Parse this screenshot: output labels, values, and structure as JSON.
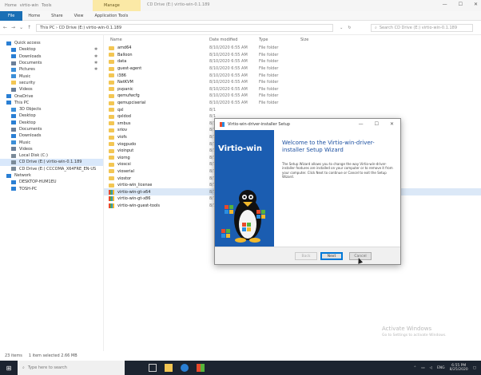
{
  "titlebar": {
    "qat_labels": [
      "Home",
      "virtio-win",
      "Tools"
    ],
    "ribbon_context": "Manage",
    "title": "CD Drive (E:) virtio-win-0.1.189",
    "controls": [
      "—",
      "☐",
      "✕"
    ]
  },
  "ribbon": {
    "file": "File",
    "tabs": [
      "Home",
      "Share",
      "View",
      "Application Tools"
    ]
  },
  "address": {
    "path": "This PC  ›  CD Drive (E:) virtio-win-0.1.189",
    "search_placeholder": "Search CD Drive (E:) virtio-win-0.1.189"
  },
  "nav": {
    "items": [
      {
        "label": "Quick access",
        "icon": "star-icon",
        "color": "#2a7fd4",
        "indent": false,
        "pinned": false
      },
      {
        "label": "Desktop",
        "icon": "desktop-icon",
        "color": "#2a7fd4",
        "indent": true,
        "pinned": true
      },
      {
        "label": "Downloads",
        "icon": "download-icon",
        "color": "#2a7fd4",
        "indent": true,
        "pinned": true
      },
      {
        "label": "Documents",
        "icon": "document-icon",
        "color": "#6b7f99",
        "indent": true,
        "pinned": true
      },
      {
        "label": "Pictures",
        "icon": "picture-icon",
        "color": "#3c8fd8",
        "indent": true,
        "pinned": true
      },
      {
        "label": "Music",
        "icon": "music-icon",
        "color": "#3c8fd8",
        "indent": true,
        "pinned": false
      },
      {
        "label": "security",
        "icon": "folder-icon",
        "color": "#f3c653",
        "indent": true,
        "pinned": false
      },
      {
        "label": "Videos",
        "icon": "video-icon",
        "color": "#6b7f99",
        "indent": true,
        "pinned": false
      },
      {
        "label": "OneDrive",
        "icon": "cloud-icon",
        "color": "#2a7fd4",
        "indent": false,
        "pinned": false
      },
      {
        "label": "This PC",
        "icon": "pc-icon",
        "color": "#2a7fd4",
        "indent": false,
        "pinned": false
      },
      {
        "label": "3D Objects",
        "icon": "cube-icon",
        "color": "#3c8fd8",
        "indent": true,
        "pinned": false
      },
      {
        "label": "Desktop",
        "icon": "desktop-icon",
        "color": "#2a7fd4",
        "indent": true,
        "pinned": false
      },
      {
        "label": "Desktop",
        "icon": "desktop-icon",
        "color": "#2a7fd4",
        "indent": true,
        "pinned": false
      },
      {
        "label": "Documents",
        "icon": "document-icon",
        "color": "#6b7f99",
        "indent": true,
        "pinned": false
      },
      {
        "label": "Downloads",
        "icon": "download-icon",
        "color": "#2a7fd4",
        "indent": true,
        "pinned": false
      },
      {
        "label": "Music",
        "icon": "music-icon",
        "color": "#3c8fd8",
        "indent": true,
        "pinned": false
      },
      {
        "label": "Videos",
        "icon": "video-icon",
        "color": "#6b7f99",
        "indent": true,
        "pinned": false
      },
      {
        "label": "Local Disk (C:)",
        "icon": "drive-icon",
        "color": "#7a8a99",
        "indent": true,
        "pinned": false
      },
      {
        "label": "CD Drive (E:) virtio-win-0.1.189",
        "icon": "cd-drive-icon",
        "color": "#7a8a99",
        "indent": true,
        "pinned": false,
        "selected": true
      },
      {
        "label": "CD Drive (E:) CCCOMA_X64FRE_EN-US",
        "icon": "cd-drive-icon",
        "color": "#7a8a99",
        "indent": true,
        "pinned": false
      },
      {
        "label": "Network",
        "icon": "network-icon",
        "color": "#2a7fd4",
        "indent": false,
        "pinned": false
      },
      {
        "label": "DESKTOP-HUM1EU",
        "icon": "computer-icon",
        "color": "#2a7fd4",
        "indent": true,
        "pinned": false
      },
      {
        "label": "TOSH-PC",
        "icon": "computer-icon",
        "color": "#2a7fd4",
        "indent": true,
        "pinned": false
      }
    ]
  },
  "files": {
    "headers": [
      "Name",
      "Date modified",
      "Type",
      "Size"
    ],
    "rows": [
      {
        "name": "amd64",
        "date": "8/10/2020 6:55 AM",
        "type": "File folder",
        "kind": "folder"
      },
      {
        "name": "Balloon",
        "date": "8/10/2020 6:55 AM",
        "type": "File folder",
        "kind": "folder"
      },
      {
        "name": "data",
        "date": "8/10/2020 6:55 AM",
        "type": "File folder",
        "kind": "folder"
      },
      {
        "name": "guest-agent",
        "date": "8/10/2020 6:55 AM",
        "type": "File folder",
        "kind": "folder"
      },
      {
        "name": "i386",
        "date": "8/10/2020 6:55 AM",
        "type": "File folder",
        "kind": "folder"
      },
      {
        "name": "NetKVM",
        "date": "8/10/2020 6:55 AM",
        "type": "File folder",
        "kind": "folder"
      },
      {
        "name": "pvpanic",
        "date": "8/10/2020 6:55 AM",
        "type": "File folder",
        "kind": "folder"
      },
      {
        "name": "qemufwcfg",
        "date": "8/10/2020 6:55 AM",
        "type": "File folder",
        "kind": "folder"
      },
      {
        "name": "qemupciserial",
        "date": "8/10/2020 6:55 AM",
        "type": "File folder",
        "kind": "folder"
      },
      {
        "name": "qxl",
        "date": "8/1",
        "type": "",
        "kind": "folder"
      },
      {
        "name": "qxldod",
        "date": "8/1",
        "type": "",
        "kind": "folder"
      },
      {
        "name": "smbus",
        "date": "8/1",
        "type": "",
        "kind": "folder"
      },
      {
        "name": "sriov",
        "date": "8/1",
        "type": "",
        "kind": "folder"
      },
      {
        "name": "viofs",
        "date": "8/1",
        "type": "",
        "kind": "folder"
      },
      {
        "name": "viogpudo",
        "date": "8/1",
        "type": "",
        "kind": "folder"
      },
      {
        "name": "vioinput",
        "date": "8/1",
        "type": "",
        "kind": "folder"
      },
      {
        "name": "viorng",
        "date": "8/1",
        "type": "",
        "kind": "folder"
      },
      {
        "name": "vioscsi",
        "date": "8/1",
        "type": "",
        "kind": "folder"
      },
      {
        "name": "vioserial",
        "date": "8/1",
        "type": "",
        "kind": "folder"
      },
      {
        "name": "viostor",
        "date": "8/1",
        "type": "",
        "kind": "folder"
      },
      {
        "name": "virtio-win_license",
        "date": "8/1",
        "type": "",
        "kind": "folder"
      },
      {
        "name": "virtio-win-gt-x64",
        "date": "8/1",
        "type": "",
        "kind": "exe",
        "selected": true
      },
      {
        "name": "virtio-win-gt-x86",
        "date": "8/1",
        "type": "",
        "kind": "exe"
      },
      {
        "name": "virtio-win-guest-tools",
        "date": "8/1",
        "type": "",
        "kind": "exe"
      }
    ]
  },
  "watermark": {
    "line1": "Activate Windows",
    "line2": "Go to Settings to activate Windows."
  },
  "status": {
    "items_count": "23 items",
    "selection": "1 item selected 2.66 MB"
  },
  "taskbar": {
    "search_placeholder": "Type here to search",
    "tray_text": "ENG",
    "time": "6:55 PM",
    "date": "8/25/2020"
  },
  "dialog": {
    "title": "Virtio-win-driver-installer Setup",
    "banner_text": "Virtio-win",
    "heading": "Welcome to the Virtio-win-driver-installer Setup Wizard",
    "body": "The Setup Wizard allows you to change the way Virtio-win-driver-installer features are installed on your computer or to remove it from your computer. Click Next to continue or Cancel to exit the Setup Wizard.",
    "buttons": {
      "back": "Back",
      "next": "Next",
      "cancel": "Cancel"
    }
  }
}
